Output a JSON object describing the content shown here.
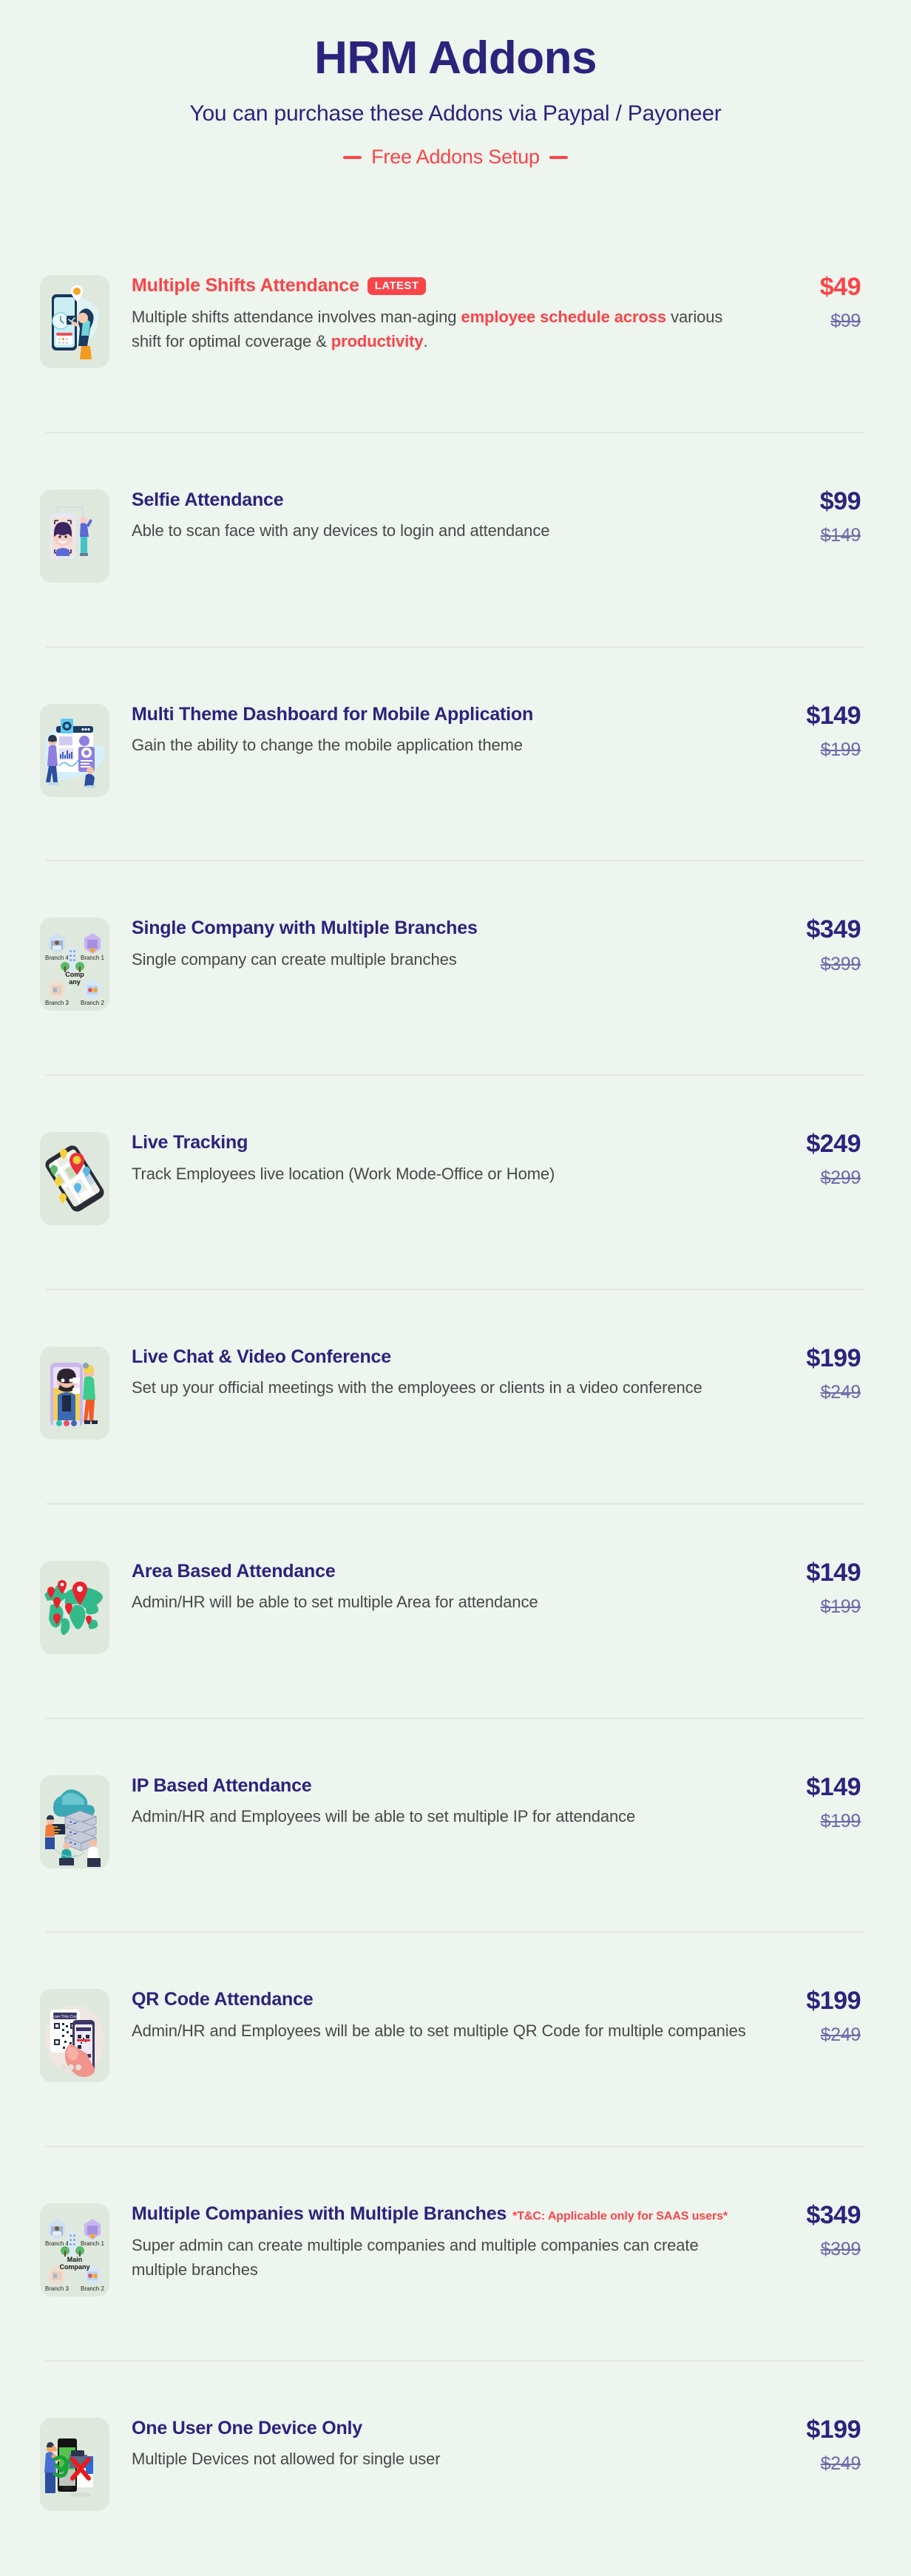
{
  "header": {
    "title": "HRM Addons",
    "subtitle": "You can purchase these Addons via Paypal / Payoneer",
    "tagline": "Free Addons Setup"
  },
  "colors": {
    "page_background": "#eef4ee",
    "tile_background": "#dfe8dd",
    "navy": "#2b237c",
    "red": "#f94449",
    "muted_text": "#454a49",
    "strikethrough": "#6b6ba8",
    "divider": "#e3e7e3"
  },
  "addons": [
    {
      "title": "Multiple Shifts Attendance",
      "badge": "LATEST",
      "title_highlight": true,
      "desc_parts": [
        {
          "text": "Multiple shifts attendance involves man-aging ",
          "em": false
        },
        {
          "text": "employee schedule across",
          "em": true
        },
        {
          "text": " various shift for optimal coverage & ",
          "em": false
        },
        {
          "text": "productivity",
          "em": true
        },
        {
          "text": ".",
          "em": false
        }
      ],
      "price": "$49",
      "price_was": "$99",
      "icon": "multiple-shifts-attendance-illustration"
    },
    {
      "title": "Selfie Attendance",
      "desc_parts": [
        {
          "text": "Able to scan face with any devices to login and attendance",
          "em": false
        }
      ],
      "price": "$99",
      "price_was": "$149",
      "icon": "selfie-attendance-illustration"
    },
    {
      "title": "Multi Theme Dashboard for Mobile Application",
      "desc_parts": [
        {
          "text": "Gain the ability to change the mobile application theme",
          "em": false
        }
      ],
      "price": "$149",
      "price_was": "$199",
      "icon": "multi-theme-dashboard-illustration"
    },
    {
      "title": "Single Company with Multiple Branches",
      "desc_parts": [
        {
          "text": "Single company can create multiple branches",
          "em": false
        }
      ],
      "price": "$349",
      "price_was": "$399",
      "icon": "single-company-branches-illustration",
      "icon_labels": {
        "center": "Comp any",
        "b1": "Branch 1",
        "b2": "Branch 2",
        "b3": "Branch 3",
        "b4": "Branch 4"
      }
    },
    {
      "title": "Live Tracking",
      "desc_parts": [
        {
          "text": "Track Employees live location (Work Mode-Office or Home)",
          "em": false
        }
      ],
      "price": "$249",
      "price_was": "$299",
      "icon": "live-tracking-illustration"
    },
    {
      "title": "Live Chat & Video Conference",
      "desc_parts": [
        {
          "text": "Set up your official meetings with the employees or clients in a video conference",
          "em": false
        }
      ],
      "price": "$199",
      "price_was": "$249",
      "icon": "live-chat-video-conference-illustration"
    },
    {
      "title": "Area Based Attendance",
      "desc_parts": [
        {
          "text": "Admin/HR will be able to set multiple Area for attendance",
          "em": false
        }
      ],
      "price": "$149",
      "price_was": "$199",
      "icon": "area-based-attendance-illustration"
    },
    {
      "title": "IP Based Attendance",
      "desc_parts": [
        {
          "text": "Admin/HR and Employees will be able to set multiple IP for attendance",
          "em": false
        }
      ],
      "price": "$149",
      "price_was": "$199",
      "icon": "ip-based-attendance-illustration"
    },
    {
      "title": "QR Code Attendance",
      "desc_parts": [
        {
          "text": "Admin/HR and Employees will be able to set multiple QR Code for multiple companies",
          "em": false
        }
      ],
      "price": "$199",
      "price_was": "$249",
      "icon": "qr-code-attendance-illustration"
    },
    {
      "title": "Multiple Companies with Multiple Branches",
      "tc_note": "*T&C: Applicable only for SAAS users*",
      "desc_parts": [
        {
          "text": "Super admin can create multiple companies and multiple companies can create multiple branches",
          "em": false
        }
      ],
      "price": "$349",
      "price_was": "$399",
      "icon": "multiple-companies-branches-illustration",
      "icon_labels": {
        "center": "Main Company",
        "b1": "Branch 1",
        "b2": "Branch 2",
        "b3": "Branch 3",
        "b4": "Branch 4"
      }
    },
    {
      "title": "One User One Device Only",
      "desc_parts": [
        {
          "text": "Multiple Devices not allowed for single user",
          "em": false
        }
      ],
      "price": "$199",
      "price_was": "$249",
      "icon": "one-user-one-device-illustration"
    }
  ]
}
